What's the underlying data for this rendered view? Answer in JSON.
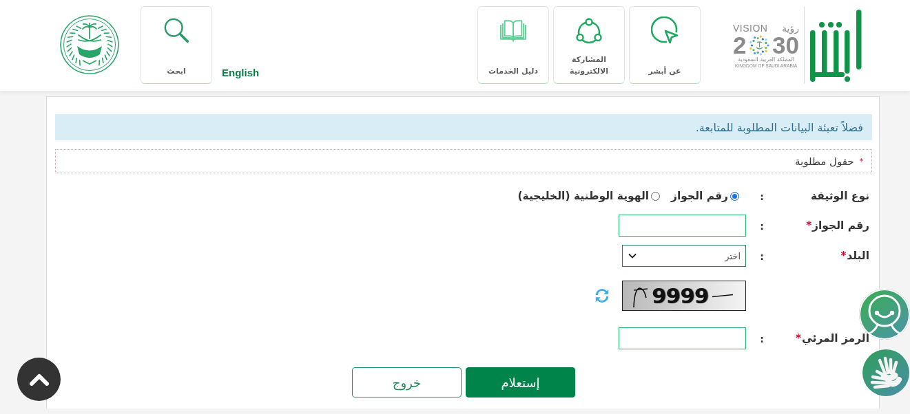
{
  "header": {
    "logo": {
      "vision_word_ar": "رؤية",
      "vision_word_en": "VISION",
      "year_start": "2",
      "year_end": "30",
      "country_ar": "المملكة العربية السعودية",
      "country_en": "KINGDOM OF SAUDI ARABIA"
    },
    "nav_tiles": [
      {
        "label": "عن أبشر"
      },
      {
        "label": "المشاركة الالكترونية"
      },
      {
        "label": "دليل الخدمات"
      }
    ],
    "language_link": "English",
    "search": {
      "label": "ابحث"
    }
  },
  "form": {
    "alert": "فضلاً تعبئة البيانات المطلوبة للمتابعة.",
    "required_note": {
      "mark": "*",
      "text": "حقول مطلوبة"
    },
    "fields": [
      {
        "kind": "radio",
        "label": "نوع الوثيقة",
        "separator": ":",
        "options": [
          {
            "label": "رقم الجواز",
            "selected": true
          },
          {
            "label": "الهوية الوطنية (الخليجية)",
            "selected": false
          }
        ]
      },
      {
        "kind": "text",
        "label": "رقم الجواز",
        "required_mark": "*",
        "separator": ":"
      },
      {
        "kind": "select",
        "label": "البلد",
        "required_mark": "*",
        "separator": ":",
        "value": "اختر"
      },
      {
        "kind": "captcha",
        "code": "9999"
      },
      {
        "kind": "text",
        "label": "الرمز المرئي",
        "required_mark": "*",
        "separator": ":"
      }
    ],
    "buttons": [
      {
        "label": "إستعلام",
        "kind": "primary"
      },
      {
        "label": "خروج",
        "kind": "secondary"
      }
    ]
  }
}
